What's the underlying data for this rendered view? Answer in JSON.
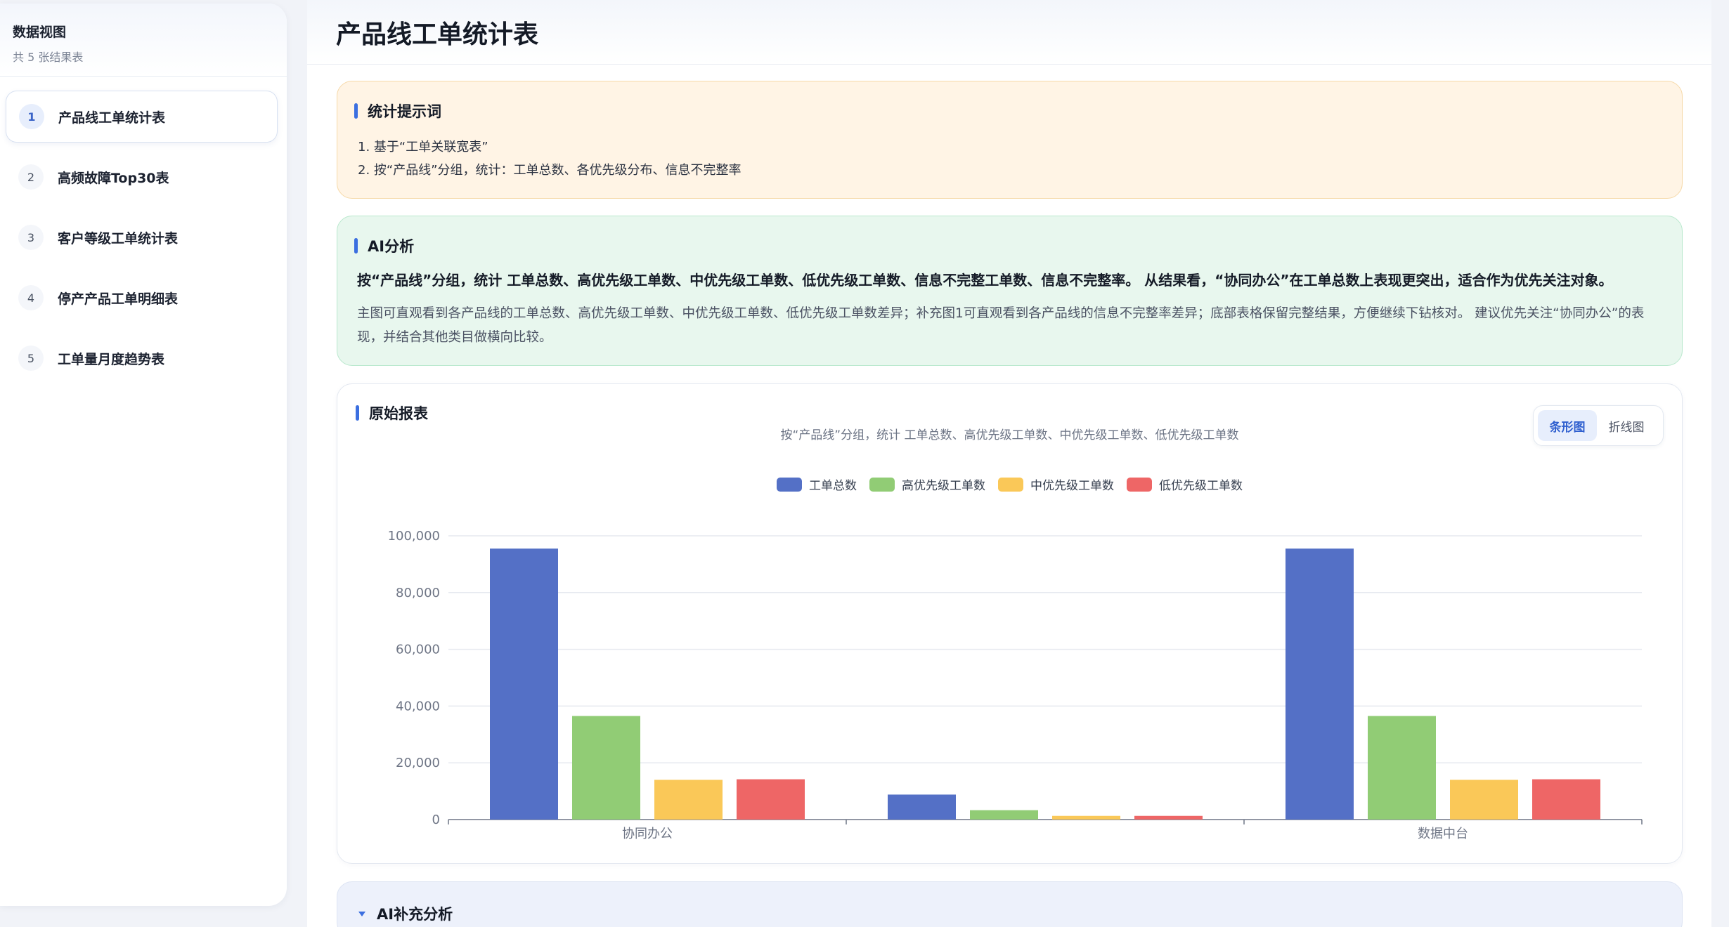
{
  "sidebar": {
    "title": "数据视图",
    "subtitle": "共 5 张结果表",
    "items": [
      {
        "num": "1",
        "label": "产品线工单统计表"
      },
      {
        "num": "2",
        "label": "高频故障Top30表"
      },
      {
        "num": "3",
        "label": "客户等级工单统计表"
      },
      {
        "num": "4",
        "label": "停产产品工单明细表"
      },
      {
        "num": "5",
        "label": "工单量月度趋势表"
      }
    ]
  },
  "page": {
    "title": "产品线工单统计表"
  },
  "prompt": {
    "title": "统计提示词",
    "lines": [
      "1. 基于“工单关联宽表”",
      "2. 按“产品线”分组，统计：工单总数、各优先级分布、信息不完整率"
    ]
  },
  "ai": {
    "title": "AI分析",
    "summary": "按“产品线”分组，统计 工单总数、高优先级工单数、中优先级工单数、低优先级工单数、信息不完整工单数、信息不完整率。 从结果看，“协同办公”在工单总数上表现更突出，适合作为优先关注对象。",
    "detail": "主图可直观看到各产品线的工单总数、高优先级工单数、中优先级工单数、低优先级工单数差异；补充图1可直观看到各产品线的信息不完整率差异；底部表格保留完整结果，方便继续下钻核对。 建议优先关注“协同办公”的表现，并结合其他类目做横向比较。"
  },
  "report": {
    "title": "原始报表",
    "subtitle": "按“产品线”分组，统计 工单总数、高优先级工单数、中优先级工单数、低优先级工单数",
    "toggle": {
      "bar": "条形图",
      "line": "折线图",
      "active": "bar"
    }
  },
  "chart_data": {
    "type": "bar",
    "categories": [
      "协同办公",
      "",
      "数据中台"
    ],
    "series": [
      {
        "name": "工单总数",
        "color": "#5470c6",
        "values": [
          95500,
          8800,
          95500
        ]
      },
      {
        "name": "高优先级工单数",
        "color": "#91cc75",
        "values": [
          36500,
          3300,
          36500
        ]
      },
      {
        "name": "中优先级工单数",
        "color": "#fac858",
        "values": [
          14000,
          1300,
          14000
        ]
      },
      {
        "name": "低优先级工单数",
        "color": "#ee6666",
        "values": [
          14200,
          1300,
          14200
        ]
      }
    ],
    "ylim": [
      0,
      100000
    ],
    "yticks": [
      "0",
      "20,000",
      "40,000",
      "60,000",
      "80,000",
      "100,000"
    ],
    "grid": true,
    "legend": "top-center"
  },
  "supplement": {
    "title": "AI补充分析"
  }
}
